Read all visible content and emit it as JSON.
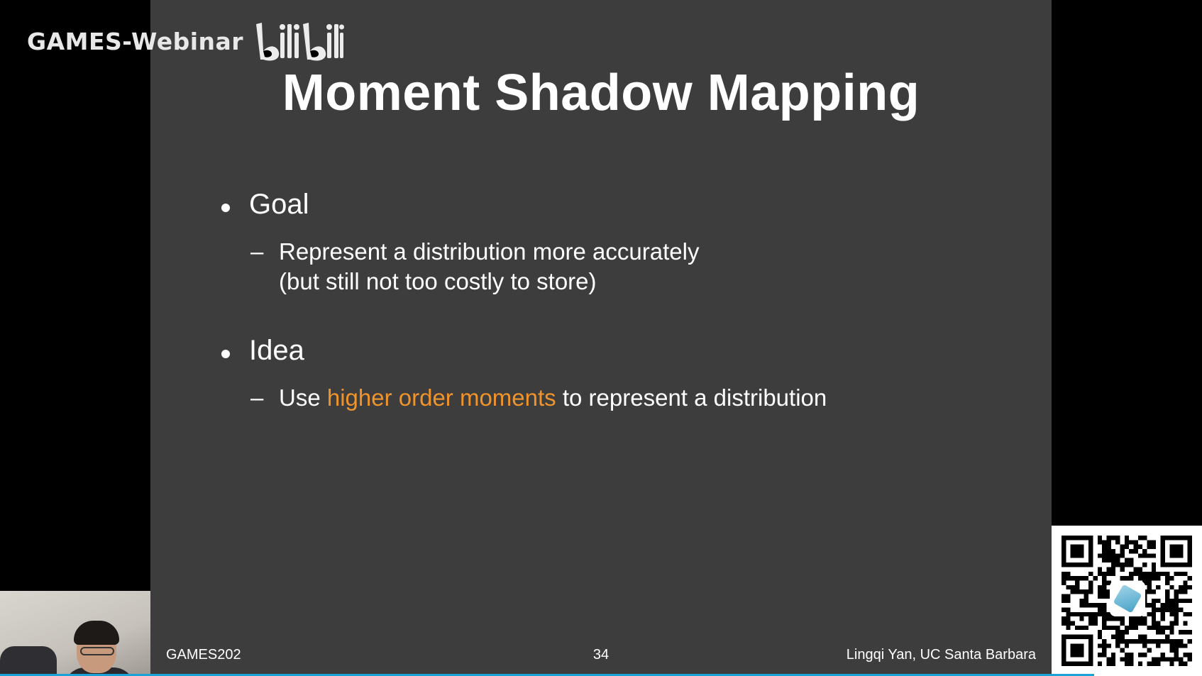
{
  "overlay": {
    "watermark_text": "GAMES-Webinar",
    "watermark_logo": "bilibili",
    "video_progress_fraction": 0.91
  },
  "slide": {
    "title": "Moment Shadow Mapping",
    "bullets": [
      {
        "heading": "Goal",
        "sub": [
          {
            "lines": [
              "Represent a distribution more accurately",
              "(but still not too costly to store)"
            ]
          }
        ]
      },
      {
        "heading": "Idea",
        "sub": [
          {
            "before": "Use",
            "highlight": "higher order moments",
            "after": "to represent a distribution"
          }
        ]
      }
    ],
    "footer": {
      "left": "GAMES202",
      "center": "34",
      "right": "Lingqi Yan, UC Santa Barbara"
    }
  },
  "colors": {
    "slide_background": "#3d3d3d",
    "highlight": "#f0932b",
    "progress_bar": "#1aa3d6"
  },
  "icons": {
    "qr": "qr-code-icon",
    "cube": "cube-logo-icon"
  }
}
